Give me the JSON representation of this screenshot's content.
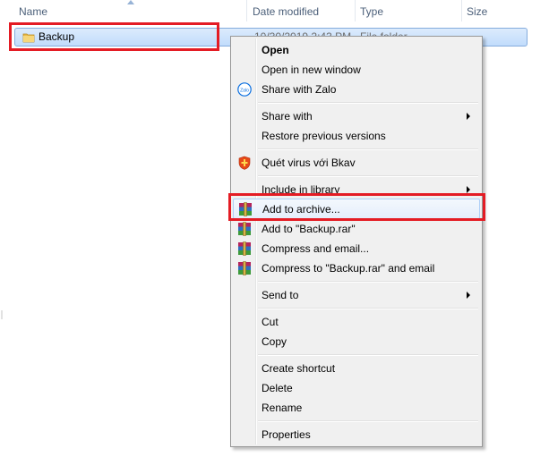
{
  "columns": {
    "name": "Name",
    "date_modified": "Date modified",
    "type": "Type",
    "size": "Size"
  },
  "file": {
    "name": "Backup",
    "date_modified": "10/30/2019 2:43 PM",
    "type": "File folder"
  },
  "menu": {
    "open": "Open",
    "open_new_window": "Open in new window",
    "share_zalo": "Share with Zalo",
    "share_with": "Share with",
    "restore_versions": "Restore previous versions",
    "scan_bkav": "Quét virus với Bkav",
    "include_library": "Include in library",
    "add_archive": "Add to archive...",
    "add_to_rar": "Add to \"Backup.rar\"",
    "compress_email": "Compress and email...",
    "compress_rar_email": "Compress to \"Backup.rar\" and email",
    "send_to": "Send to",
    "cut": "Cut",
    "copy": "Copy",
    "create_shortcut": "Create shortcut",
    "delete": "Delete",
    "rename": "Rename",
    "properties": "Properties"
  },
  "icons": {
    "zalo": "zalo-icon",
    "bkav": "bkav-shield-icon",
    "winrar": "winrar-icon",
    "folder": "folder-icon"
  },
  "colors": {
    "highlight_red": "#e41c24",
    "selection_blue": "#c1dcfc",
    "header_text": "#4c607a"
  }
}
